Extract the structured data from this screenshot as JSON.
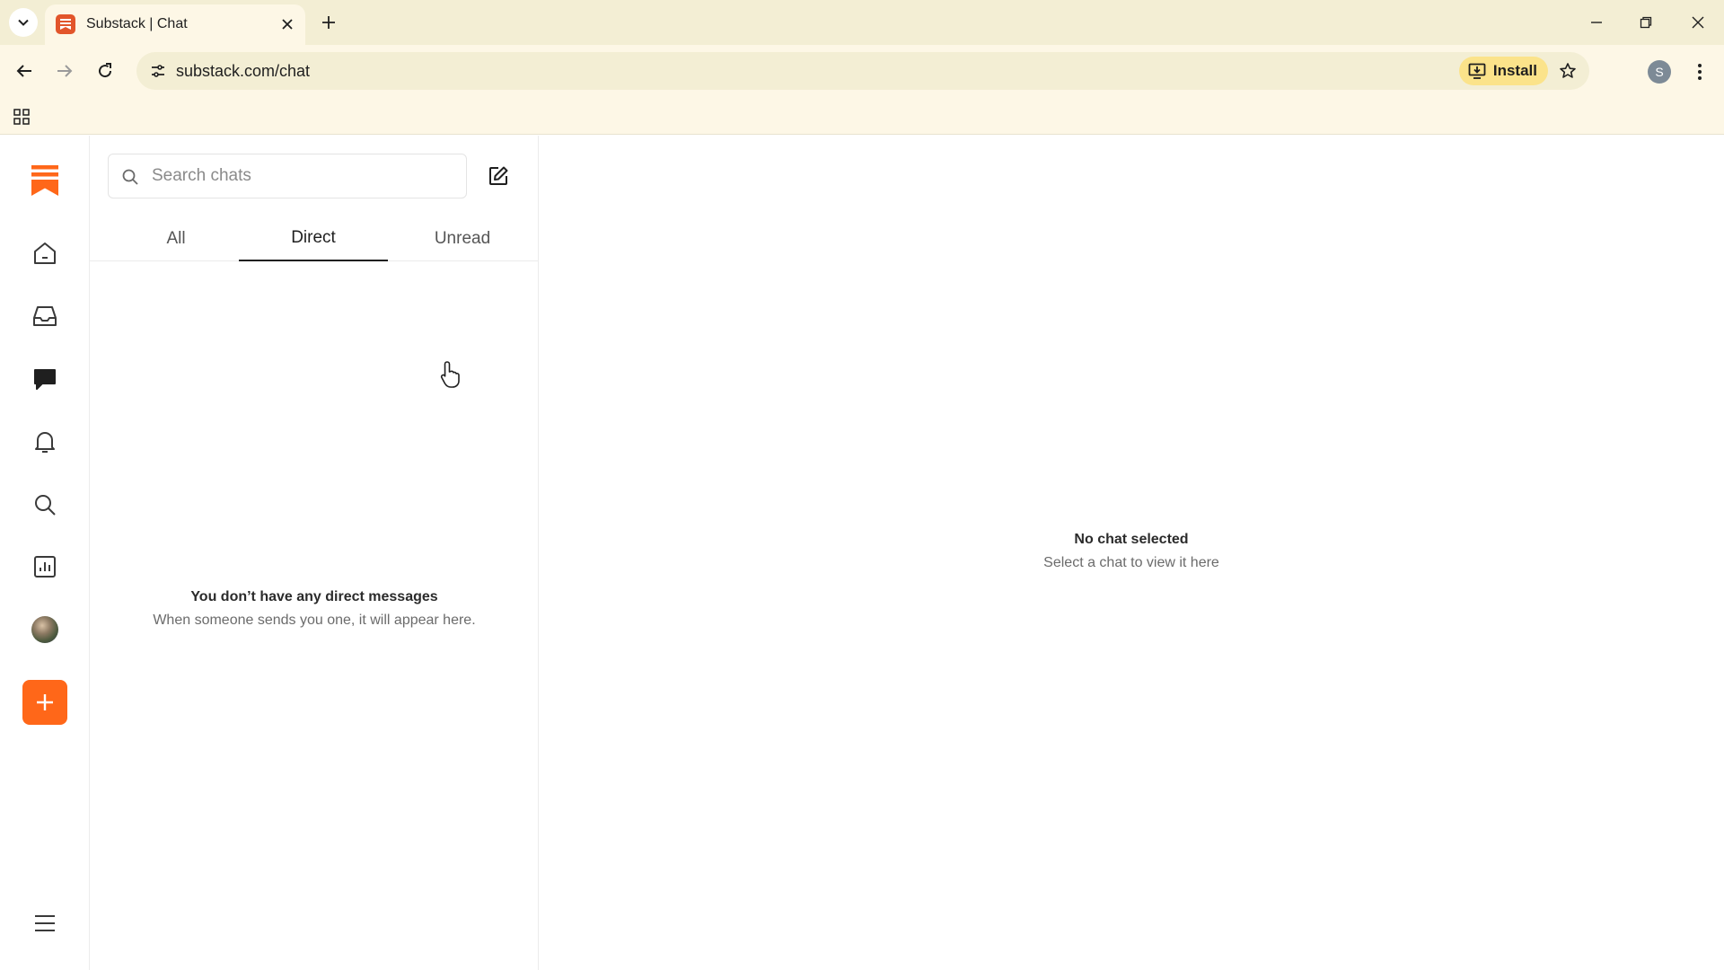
{
  "browser": {
    "tab_title": "Substack | Chat",
    "url": "substack.com/chat",
    "install_label": "Install",
    "profile_initial": "S"
  },
  "chat": {
    "search": {
      "placeholder": "Search chats",
      "value": ""
    },
    "tabs": [
      {
        "label": "All",
        "active": false
      },
      {
        "label": "Direct",
        "active": true
      },
      {
        "label": "Unread",
        "active": false
      }
    ],
    "empty_list": {
      "title": "You don’t have any direct messages",
      "subtitle": "When someone sends you one, it will appear here."
    },
    "detail_empty": {
      "title": "No chat selected",
      "subtitle": "Select a chat to view it here"
    }
  },
  "sidebar": {
    "items": [
      "home-icon",
      "inbox-icon",
      "chat-icon",
      "notifications-icon",
      "search-icon",
      "dashboard-icon",
      "avatar",
      "create-icon",
      "menu-icon"
    ]
  },
  "colors": {
    "accent": "#ff6719",
    "chrome": "#f3eed4",
    "install_highlight": "#fbe38a"
  }
}
